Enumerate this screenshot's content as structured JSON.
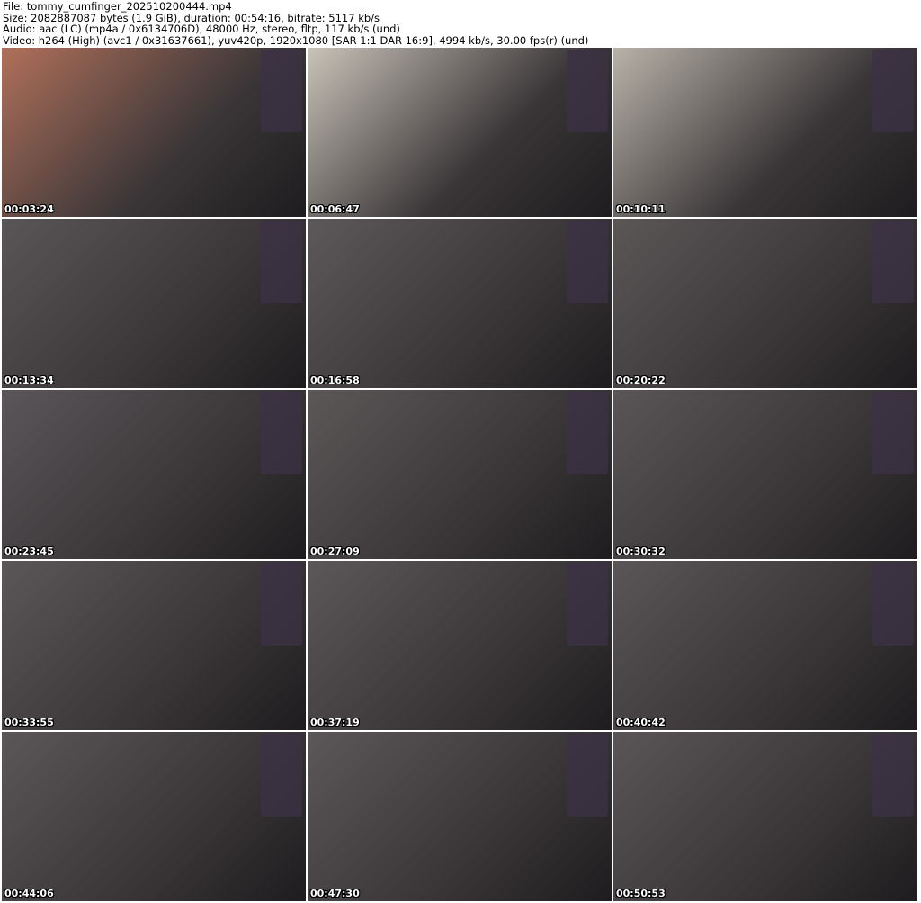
{
  "header": {
    "file": "File: tommy_cumfinger_202510200444.mp4",
    "size": "Size: 2082887087 bytes (1.9 GiB), duration: 00:54:16, bitrate: 5117 kb/s",
    "audio": "Audio: aac (LC) (mp4a / 0x6134706D), 48000 Hz, stereo, fltp, 117 kb/s (und)",
    "video": "Video: h264 (High) (avc1 / 0x31637661), yuv420p, 1920x1080 [SAR 1:1 DAR 16:9], 4994 kb/s, 30.00 fps(r) (und)"
  },
  "thumbnails": [
    {
      "time": "00:03:24",
      "tone": "#b0705a"
    },
    {
      "time": "00:06:47",
      "tone": "#c9c3b8"
    },
    {
      "time": "00:10:11",
      "tone": "#b8b2a8"
    },
    {
      "time": "00:13:34",
      "tone": "#5a5658"
    },
    {
      "time": "00:16:58",
      "tone": "#5d595a"
    },
    {
      "time": "00:20:22",
      "tone": "#5b5757"
    },
    {
      "time": "00:23:45",
      "tone": "#5a5659"
    },
    {
      "time": "00:27:09",
      "tone": "#5c5858"
    },
    {
      "time": "00:30:32",
      "tone": "#5a5657"
    },
    {
      "time": "00:33:55",
      "tone": "#5b5758"
    },
    {
      "time": "00:37:19",
      "tone": "#5c5859"
    },
    {
      "time": "00:40:42",
      "tone": "#5a5657"
    },
    {
      "time": "00:44:06",
      "tone": "#5b5758"
    },
    {
      "time": "00:47:30",
      "tone": "#5c5859"
    },
    {
      "time": "00:50:53",
      "tone": "#5a5657"
    }
  ]
}
